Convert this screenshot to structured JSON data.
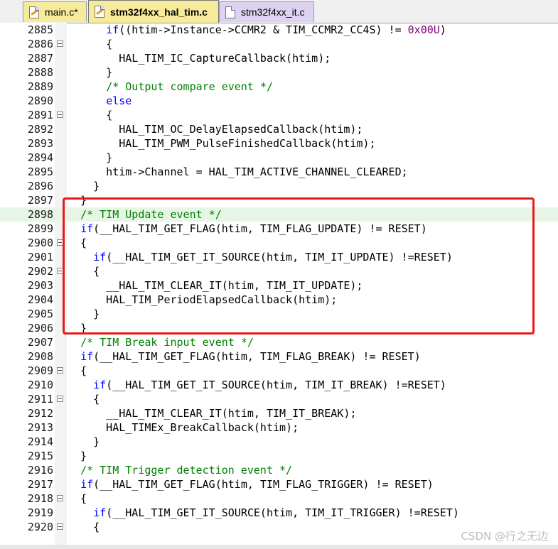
{
  "tabs": [
    {
      "label": "main.c*",
      "icon": "edit-document-icon"
    },
    {
      "label": "stm32f4xx_hal_tim.c",
      "icon": "edit-document-icon",
      "active": true
    },
    {
      "label": "stm32f4xx_it.c",
      "icon": "document-icon"
    }
  ],
  "colors": {
    "keyword": "#0000ff",
    "comment": "#008000",
    "number": "#800080",
    "annotation": "#e8191c",
    "highlight_line": "#e6f5e6"
  },
  "lines": [
    {
      "n": "2885",
      "fold": false,
      "code": [
        [
          "      ",
          ""
        ],
        [
          "if",
          "kw"
        ],
        [
          "((htim->Instance->CCMR2 & TIM_CCMR2_CC4S) != ",
          ""
        ],
        [
          "0x00U",
          "num"
        ],
        [
          ")",
          ""
        ]
      ]
    },
    {
      "n": "2886",
      "fold": true,
      "code": [
        [
          "      {",
          ""
        ]
      ]
    },
    {
      "n": "2887",
      "fold": false,
      "code": [
        [
          "        HAL_TIM_IC_CaptureCallback(htim);",
          ""
        ]
      ]
    },
    {
      "n": "2888",
      "fold": false,
      "code": [
        [
          "      }",
          ""
        ]
      ]
    },
    {
      "n": "2889",
      "fold": false,
      "code": [
        [
          "      ",
          ""
        ],
        [
          "/* Output compare event */",
          "cm"
        ]
      ]
    },
    {
      "n": "2890",
      "fold": false,
      "code": [
        [
          "      ",
          ""
        ],
        [
          "else",
          "kw"
        ]
      ]
    },
    {
      "n": "2891",
      "fold": true,
      "code": [
        [
          "      {",
          ""
        ]
      ]
    },
    {
      "n": "2892",
      "fold": false,
      "code": [
        [
          "        HAL_TIM_OC_DelayElapsedCallback(htim);",
          ""
        ]
      ]
    },
    {
      "n": "2893",
      "fold": false,
      "code": [
        [
          "        HAL_TIM_PWM_PulseFinishedCallback(htim);",
          ""
        ]
      ]
    },
    {
      "n": "2894",
      "fold": false,
      "code": [
        [
          "      }",
          ""
        ]
      ]
    },
    {
      "n": "2895",
      "fold": false,
      "code": [
        [
          "      htim->Channel = HAL_TIM_ACTIVE_CHANNEL_CLEARED;",
          ""
        ]
      ]
    },
    {
      "n": "2896",
      "fold": false,
      "code": [
        [
          "    }",
          ""
        ]
      ]
    },
    {
      "n": "2897",
      "fold": false,
      "code": [
        [
          "  }",
          ""
        ]
      ]
    },
    {
      "n": "2898",
      "fold": false,
      "hl": true,
      "code": [
        [
          "  ",
          ""
        ],
        [
          "/* TIM Update event */",
          "cm"
        ]
      ]
    },
    {
      "n": "2899",
      "fold": false,
      "code": [
        [
          "  ",
          ""
        ],
        [
          "if",
          "kw"
        ],
        [
          "(__HAL_TIM_GET_FLAG(htim, TIM_FLAG_UPDATE) != RESET)",
          ""
        ]
      ]
    },
    {
      "n": "2900",
      "fold": true,
      "code": [
        [
          "  {",
          ""
        ]
      ]
    },
    {
      "n": "2901",
      "fold": false,
      "code": [
        [
          "    ",
          ""
        ],
        [
          "if",
          "kw"
        ],
        [
          "(__HAL_TIM_GET_IT_SOURCE(htim, TIM_IT_UPDATE) !=RESET)",
          ""
        ]
      ]
    },
    {
      "n": "2902",
      "fold": true,
      "code": [
        [
          "    {",
          ""
        ]
      ]
    },
    {
      "n": "2903",
      "fold": false,
      "code": [
        [
          "      __HAL_TIM_CLEAR_IT(htim, TIM_IT_UPDATE);",
          ""
        ]
      ]
    },
    {
      "n": "2904",
      "fold": false,
      "code": [
        [
          "      HAL_TIM_PeriodElapsedCallback(htim);",
          ""
        ]
      ]
    },
    {
      "n": "2905",
      "fold": false,
      "code": [
        [
          "    }",
          ""
        ]
      ]
    },
    {
      "n": "2906",
      "fold": false,
      "code": [
        [
          "  }",
          ""
        ]
      ]
    },
    {
      "n": "2907",
      "fold": false,
      "code": [
        [
          "  ",
          ""
        ],
        [
          "/* TIM Break input event */",
          "cm"
        ]
      ]
    },
    {
      "n": "2908",
      "fold": false,
      "code": [
        [
          "  ",
          ""
        ],
        [
          "if",
          "kw"
        ],
        [
          "(__HAL_TIM_GET_FLAG(htim, TIM_FLAG_BREAK) != RESET)",
          ""
        ]
      ]
    },
    {
      "n": "2909",
      "fold": true,
      "code": [
        [
          "  {",
          ""
        ]
      ]
    },
    {
      "n": "2910",
      "fold": false,
      "code": [
        [
          "    ",
          ""
        ],
        [
          "if",
          "kw"
        ],
        [
          "(__HAL_TIM_GET_IT_SOURCE(htim, TIM_IT_BREAK) !=RESET)",
          ""
        ]
      ]
    },
    {
      "n": "2911",
      "fold": true,
      "code": [
        [
          "    {",
          ""
        ]
      ]
    },
    {
      "n": "2912",
      "fold": false,
      "code": [
        [
          "      __HAL_TIM_CLEAR_IT(htim, TIM_IT_BREAK);",
          ""
        ]
      ]
    },
    {
      "n": "2913",
      "fold": false,
      "code": [
        [
          "      HAL_TIMEx_BreakCallback(htim);",
          ""
        ]
      ]
    },
    {
      "n": "2914",
      "fold": false,
      "code": [
        [
          "    }",
          ""
        ]
      ]
    },
    {
      "n": "2915",
      "fold": false,
      "code": [
        [
          "  }",
          ""
        ]
      ]
    },
    {
      "n": "2916",
      "fold": false,
      "code": [
        [
          "  ",
          ""
        ],
        [
          "/* TIM Trigger detection event */",
          "cm"
        ]
      ]
    },
    {
      "n": "2917",
      "fold": false,
      "code": [
        [
          "  ",
          ""
        ],
        [
          "if",
          "kw"
        ],
        [
          "(__HAL_TIM_GET_FLAG(htim, TIM_FLAG_TRIGGER) != RESET)",
          ""
        ]
      ]
    },
    {
      "n": "2918",
      "fold": true,
      "code": [
        [
          "  {",
          ""
        ]
      ]
    },
    {
      "n": "2919",
      "fold": false,
      "code": [
        [
          "    ",
          ""
        ],
        [
          "if",
          "kw"
        ],
        [
          "(__HAL_TIM_GET_IT_SOURCE(htim, TIM_IT_TRIGGER) !=RESET)",
          ""
        ]
      ]
    },
    {
      "n": "2920",
      "fold": true,
      "code": [
        [
          "    {",
          ""
        ]
      ]
    }
  ],
  "watermark": "CSDN @行之无边"
}
